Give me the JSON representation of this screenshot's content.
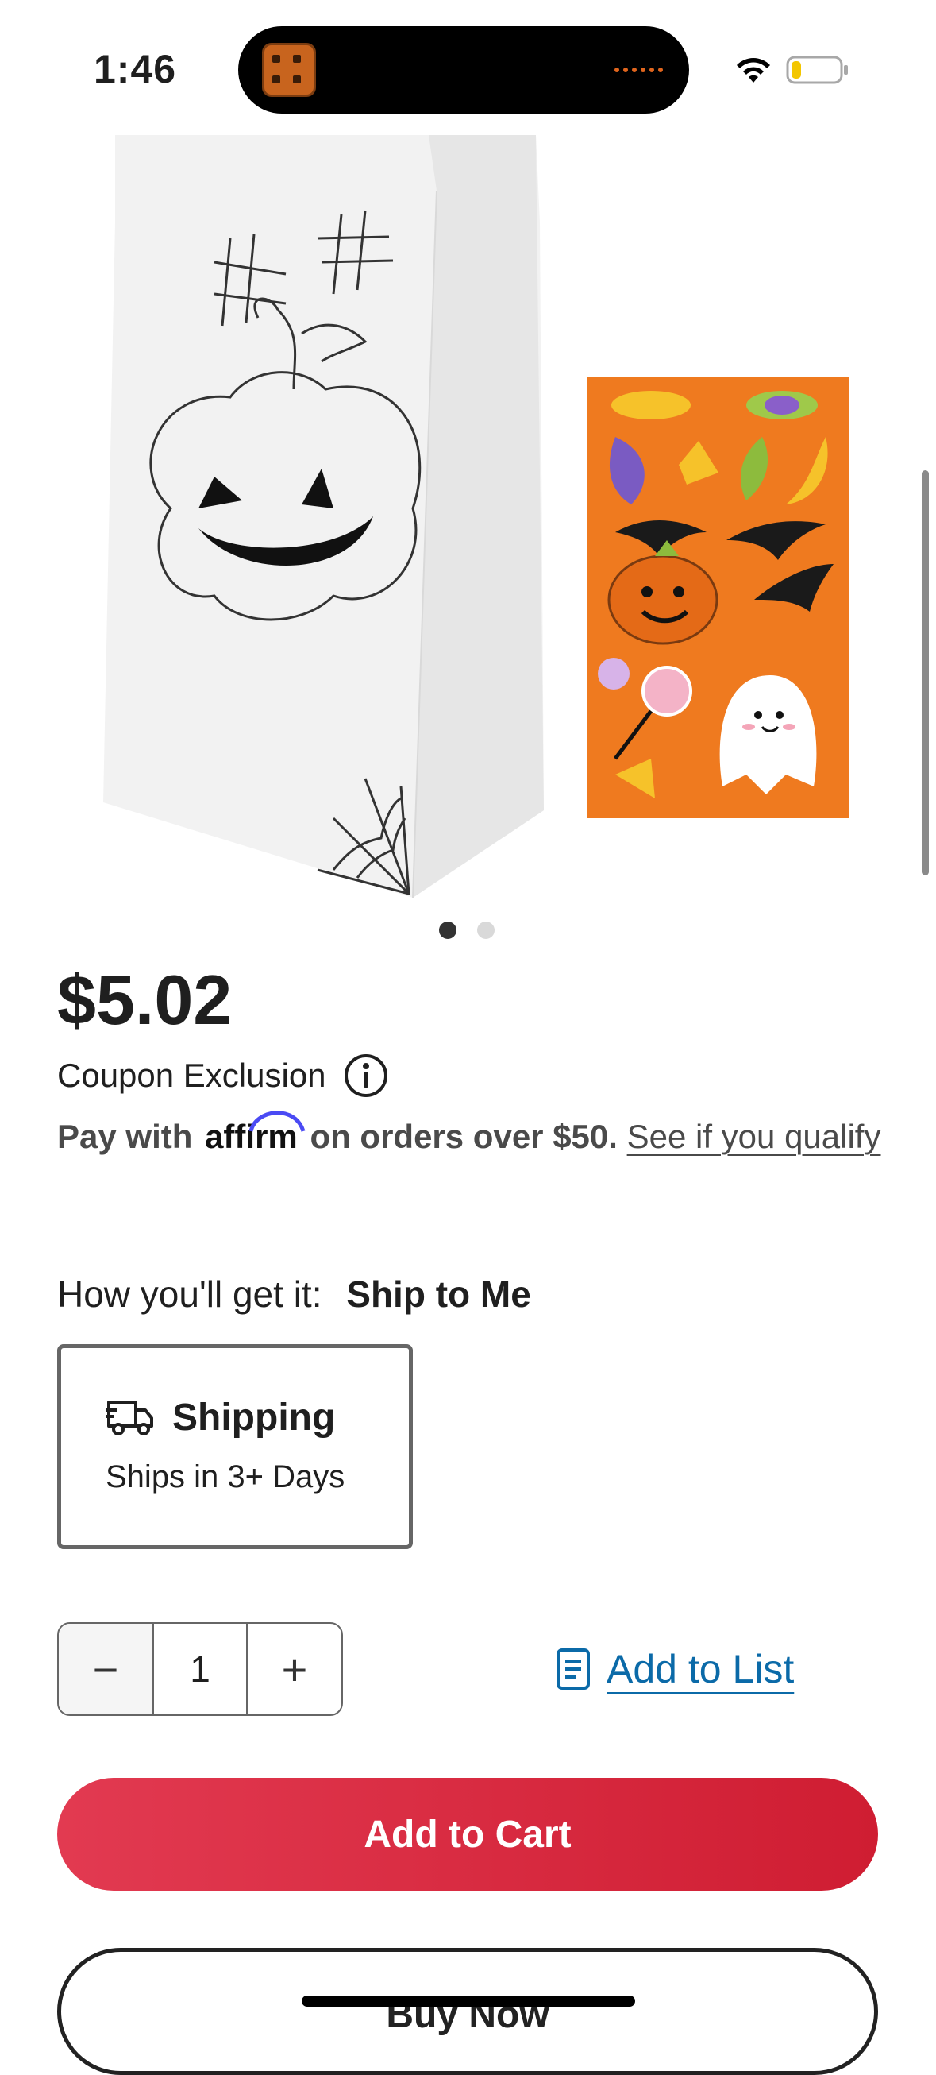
{
  "status_bar": {
    "time": "1:46"
  },
  "product": {
    "price": "$5.02",
    "coupon_text": "Coupon Exclusion",
    "affirm": {
      "prefix": "Pay with",
      "logo": "affirm",
      "suffix": "on orders over $50.",
      "link": "See if you qualify"
    },
    "carousel": {
      "total": 2,
      "active": 1
    }
  },
  "delivery": {
    "label": "How you'll get it:",
    "method": "Ship to Me",
    "option_title": "Shipping",
    "option_sub": "Ships in 3+ Days"
  },
  "quantity": {
    "minus": "−",
    "value": "1",
    "plus": "+"
  },
  "actions": {
    "add_to_list": "Add to List",
    "add_to_cart": "Add to Cart",
    "buy_now": "Buy Now"
  },
  "colors": {
    "cart_button": "#d92a40",
    "link_blue": "#0b6aa8",
    "affirm_arc": "#4a4af4",
    "sticker_bg": "#ef7a1f"
  },
  "icons": [
    "info-icon",
    "truck-icon",
    "list-icon",
    "wifi-icon",
    "battery-icon"
  ]
}
